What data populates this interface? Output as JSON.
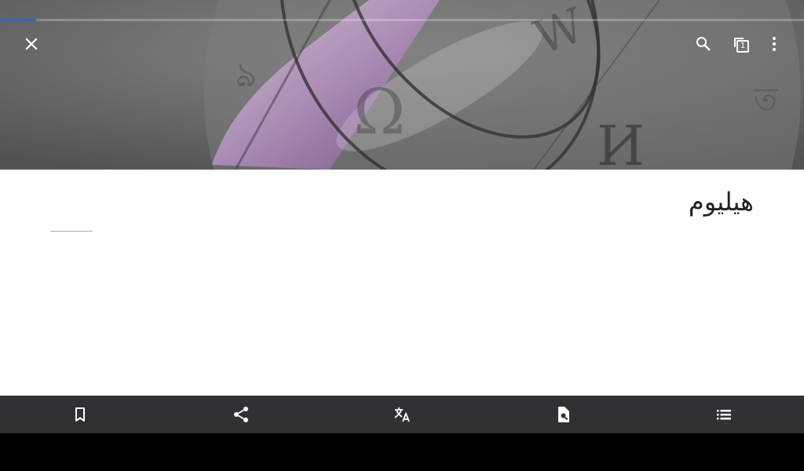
{
  "app": {
    "load_progress": 0.045,
    "tabs_count": "1",
    "accent_color": "#3366cc"
  },
  "toolbar": {
    "icons": [
      "close-icon",
      "search-icon",
      "tabs-icon",
      "more-vert-icon"
    ]
  },
  "article": {
    "title": "هيليوم"
  },
  "bottom_bar": {
    "icons": [
      "bookmark-icon",
      "share-icon",
      "translate-icon",
      "find-in-page-icon",
      "contents-icon"
    ]
  }
}
